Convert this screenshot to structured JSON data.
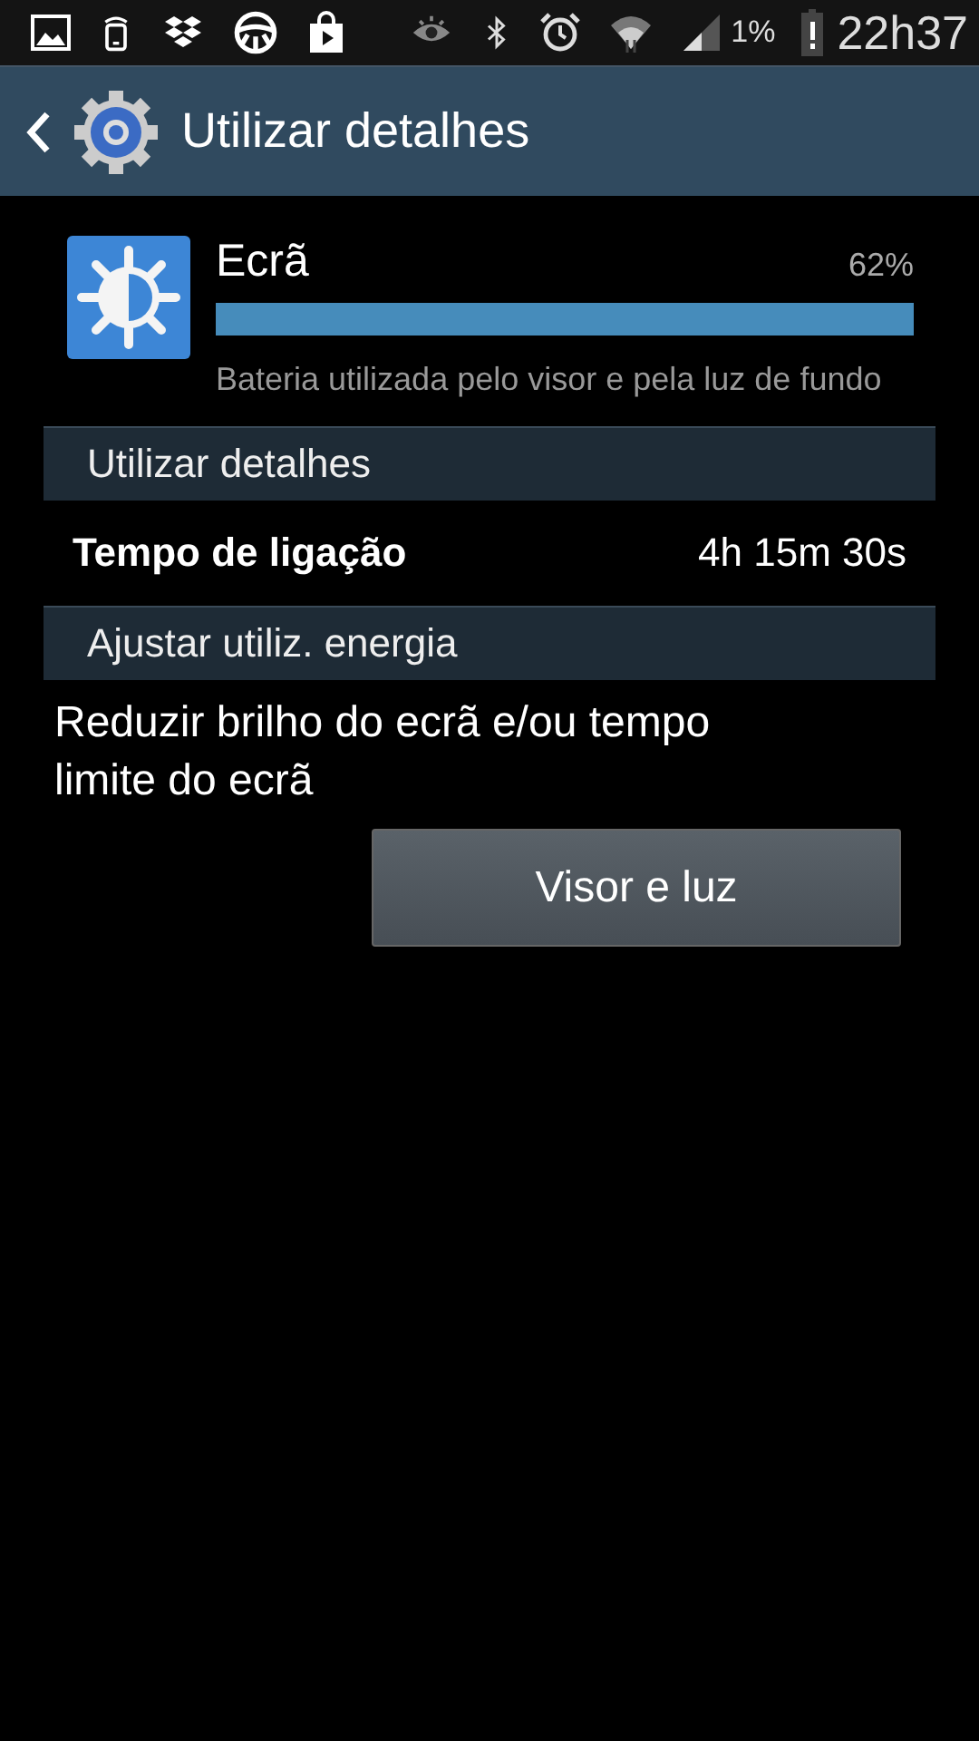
{
  "status_bar": {
    "battery_percent": "1%",
    "time": "22h37"
  },
  "header": {
    "title": "Utilizar detalhes"
  },
  "usage_item": {
    "name": "Ecrã",
    "percent": "62%",
    "description": "Bateria utilizada pelo visor e pela luz de fundo"
  },
  "sections": [
    {
      "title": "Utilizar detalhes",
      "rows": [
        {
          "label": "Tempo de ligação",
          "value": "4h 15m 30s"
        }
      ]
    },
    {
      "title": "Ajustar utiliz. energia",
      "text": "Reduzir brilho do ecrã e/ou tempo limite do ecrã",
      "button": "Visor e luz"
    }
  ]
}
